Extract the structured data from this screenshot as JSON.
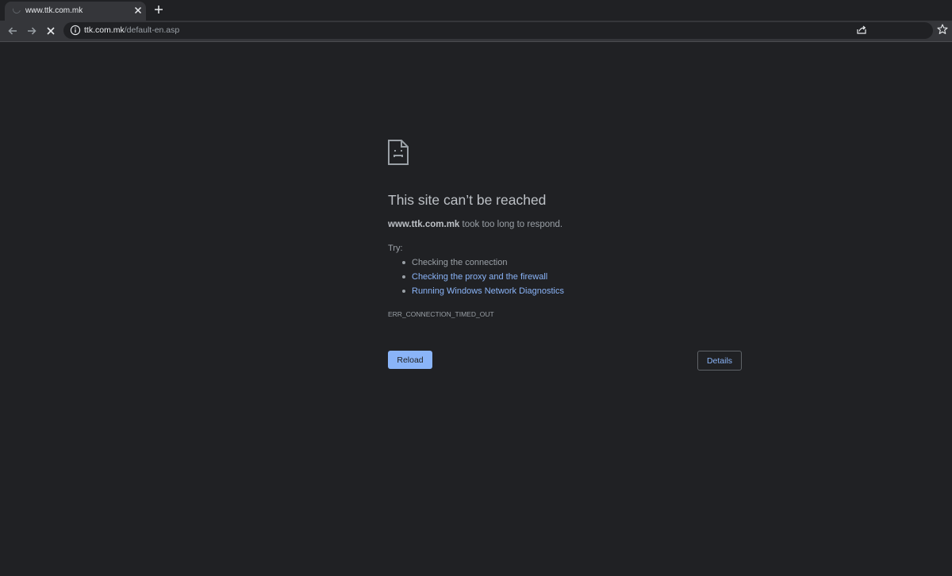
{
  "browser": {
    "tab": {
      "title": "www.ttk.com.mk"
    },
    "address_bar": {
      "host": "ttk.com.mk",
      "path": "/default-en.asp"
    }
  },
  "error_page": {
    "heading": "This site can’t be reached",
    "summary_host": "www.ttk.com.mk",
    "summary_rest": " took too long to respond.",
    "try_label": "Try:",
    "suggestions": [
      "Checking the connection",
      "Checking the proxy and the firewall",
      "Running Windows Network Diagnostics"
    ],
    "error_code": "ERR_CONNECTION_TIMED_OUT",
    "reload_label": "Reload",
    "details_label": "Details"
  },
  "colors": {
    "background": "#202124",
    "link": "#8ab4f8",
    "text": "#9aa0a6",
    "heading": "#bdc1c6"
  }
}
